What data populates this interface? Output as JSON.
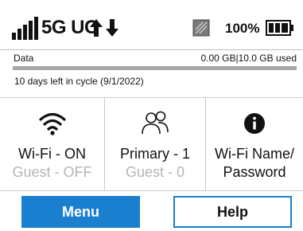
{
  "status": {
    "signal_icon": "signal-bars-icon",
    "network": "5G UC",
    "activity_icon": "up-down-arrows-icon",
    "sim_icon": "sim-card-icon",
    "battery_percent": "100%",
    "battery_level": 1.0
  },
  "data": {
    "label": "Data",
    "used_text": "0.00 GB|10.0 GB used",
    "used_fraction": 0.0,
    "cycle_text": "10 days left in cycle (9/1/2022)"
  },
  "tiles": [
    {
      "icon": "wifi-icon",
      "line1": "Wi-Fi - ON",
      "line2": "Guest - OFF"
    },
    {
      "icon": "users-icon",
      "line1": "Primary - 1",
      "line2": "Guest - 0"
    },
    {
      "icon": "info-icon",
      "line1": "Wi-Fi Name/",
      "line2": "Password"
    }
  ],
  "buttons": {
    "menu": "Menu",
    "help": "Help"
  },
  "colors": {
    "accent": "#1a7fcf",
    "muted_text": "#b5b5b5"
  }
}
